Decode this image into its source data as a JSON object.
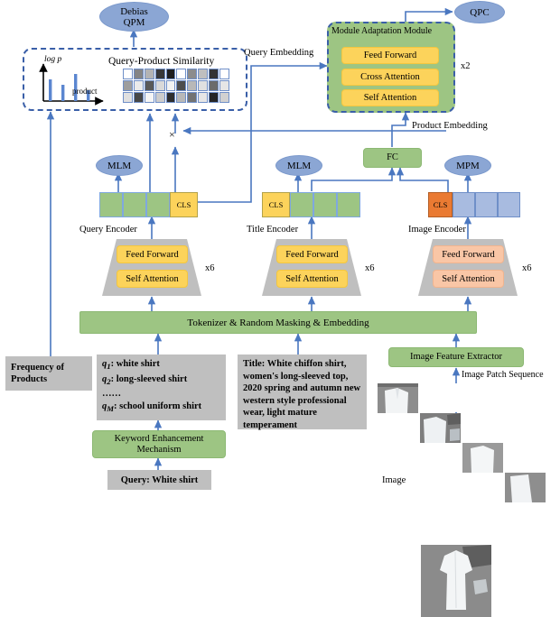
{
  "diagram": {
    "title": "Query-Product Multimodal Pretraining Architecture",
    "colors": {
      "green": "#9dc583",
      "yellow": "#fcd35b",
      "peach": "#f9c6a6",
      "blue_ellipse": "#8ba6d4",
      "gray": "#bfbfbf",
      "arrow": "#4a77c0",
      "dash_border": "#3a5fa8",
      "token_blue": "#a8bbe0",
      "cls_orange": "#ea7a32"
    }
  },
  "heads": {
    "debias_qpm": "Debias\nQPM",
    "debias_qpm_line1": "Debias",
    "debias_qpm_line2": "QPM",
    "qpc": "QPC",
    "mlm_query": "MLM",
    "mlm_title": "MLM",
    "mpm": "MPM"
  },
  "debias_panel": {
    "similarity_title": "Query-Product Similarity",
    "plot_ylabel": "log p",
    "plot_xlabel": "product",
    "bar_values": [
      0.55,
      0.38,
      0.78,
      0.25
    ],
    "matrix_rows": 3,
    "matrix_cols": 10,
    "matrix": [
      [
        1.0,
        0.52,
        0.7,
        0.22,
        0.12,
        1.0,
        0.55,
        0.75,
        0.2,
        1.0
      ],
      [
        0.62,
        0.92,
        0.35,
        0.85,
        0.95,
        0.3,
        0.72,
        0.88,
        0.42,
        0.9
      ],
      [
        0.88,
        0.28,
        0.96,
        0.8,
        0.18,
        0.72,
        0.45,
        0.9,
        0.15,
        0.82
      ]
    ]
  },
  "adaptation_module": {
    "name": "Module Adaptation Module",
    "layers": [
      "Feed Forward",
      "Cross Attention",
      "Self Attention"
    ],
    "repeat": "x2"
  },
  "edge_labels": {
    "query_embedding": "Query Embedding",
    "product_embedding": "Product Embedding",
    "multiply": "×",
    "image_patch_sequence": "Image Patch Sequence",
    "image": "Image"
  },
  "fc": {
    "label": "FC"
  },
  "encoders": [
    {
      "id": "query",
      "caption": "Query Encoder",
      "layers": [
        "Feed Forward",
        "Self Attention"
      ],
      "repeat": "x6",
      "cls_label": "CLS",
      "cls_position": "right",
      "tokens": 3,
      "token_style": "green",
      "cls_style": "yellow"
    },
    {
      "id": "title",
      "caption": "Title Encoder",
      "layers": [
        "Feed Forward",
        "Self Attention"
      ],
      "repeat": "x6",
      "cls_label": "CLS",
      "cls_position": "left",
      "tokens": 3,
      "token_style": "green",
      "cls_style": "yellow"
    },
    {
      "id": "image",
      "caption": "Image Encoder",
      "layers": [
        "Feed Forward",
        "Self Attention"
      ],
      "repeat": "x6",
      "cls_label": "CLS",
      "cls_position": "left",
      "tokens": 3,
      "token_style": "blue",
      "cls_style": "orange"
    }
  ],
  "tokenizer": {
    "label": "Tokenizer & Random Masking & Embedding"
  },
  "inputs": {
    "frequency_box": "Frequency of\nProducts",
    "frequency_line1": "Frequency of",
    "frequency_line2": "Products",
    "query_list": [
      "q₁: white shirt",
      "q₂: long-sleeved shirt",
      "……",
      "qₘ: school uniform shirt"
    ],
    "query_list_items": [
      {
        "sub": "1",
        "prefix": "q",
        "text": ": white shirt"
      },
      {
        "sub": "2",
        "prefix": "q",
        "text": ": long-sleeved shirt"
      },
      {
        "sub": "",
        "prefix": "",
        "text": "……"
      },
      {
        "sub": "M",
        "prefix": "q",
        "text": ": school uniform shirt"
      }
    ],
    "keyword_mechanism_line1": "Keyword Enhancement",
    "keyword_mechanism_line2": "Mechanism",
    "query_input": "Query: White shirt",
    "title_text": "Title: White chiffon shirt, women's long-sleeved top, 2020 spring and autumn new western style professional wear, light mature temperament",
    "image_feature_extractor": "Image Feature Extractor"
  }
}
